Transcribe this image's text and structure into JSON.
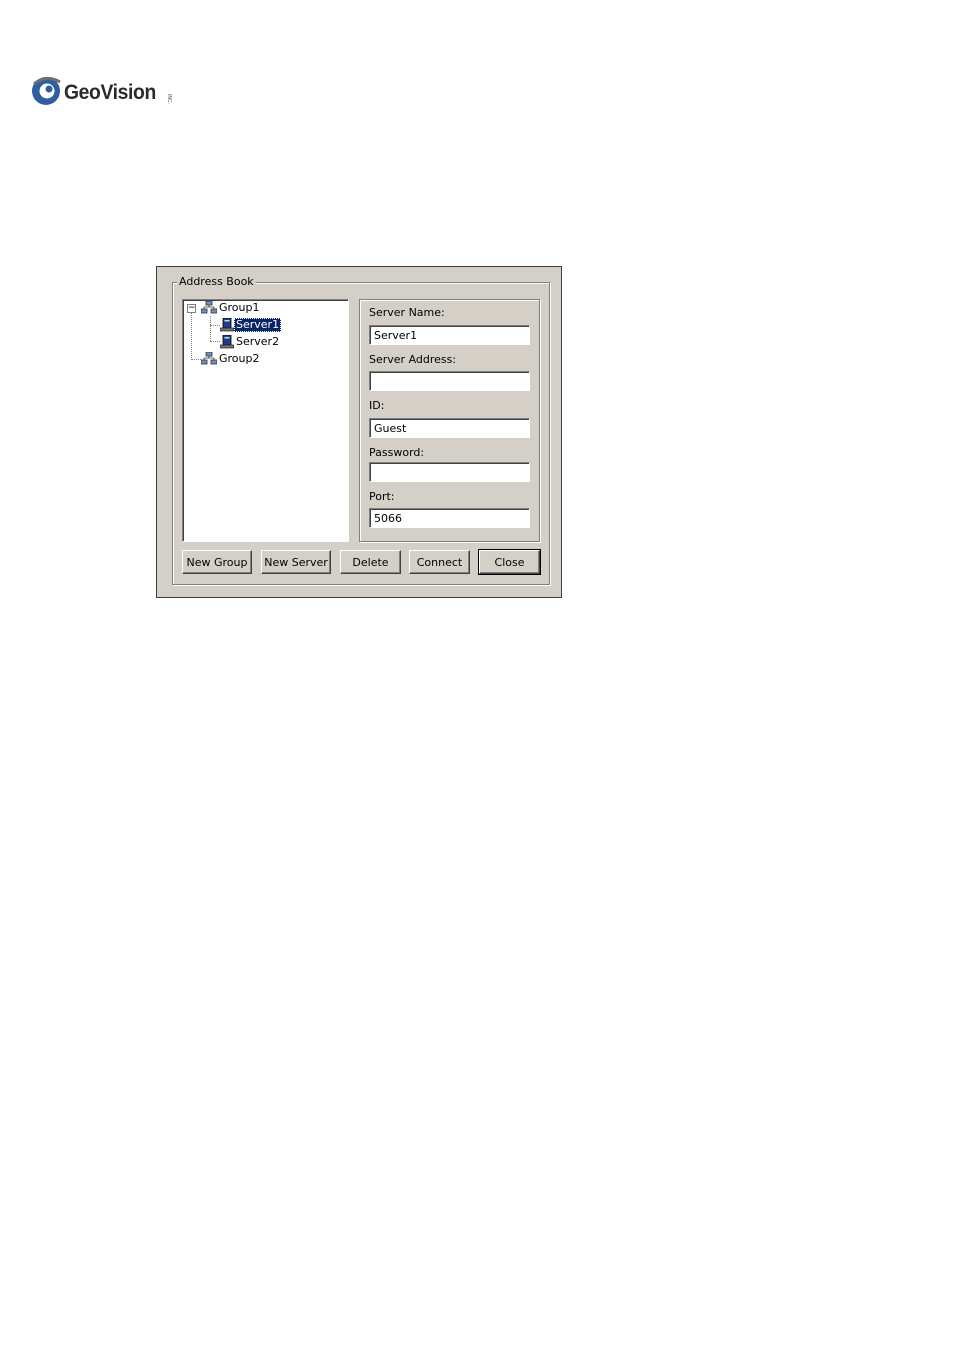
{
  "logo": {
    "brand": "GeoVision",
    "tm": "INC."
  },
  "dialog": {
    "group_title": "Address Book",
    "tree": [
      {
        "label": "Group1",
        "type": "group",
        "expander": "−"
      },
      {
        "label": "Server1",
        "type": "server",
        "selected": true
      },
      {
        "label": "Server2",
        "type": "server"
      },
      {
        "label": "Group2",
        "type": "group"
      }
    ],
    "fields": {
      "server_name": {
        "label": "Server Name:",
        "value": "Server1"
      },
      "server_address": {
        "label": "Server Address:",
        "value": ""
      },
      "id": {
        "label": "ID:",
        "value": "Guest"
      },
      "password": {
        "label": "Password:",
        "value": ""
      },
      "port": {
        "label": "Port:",
        "value": "5066"
      }
    },
    "buttons": {
      "new_group": "New Group",
      "new_server": "New Server",
      "delete": "Delete",
      "connect": "Connect",
      "close": "Close"
    }
  },
  "colors": {
    "dialog_bg": "#d4d0c8",
    "selection": "#0a246a",
    "logo_blue": "#2f5f9e"
  }
}
